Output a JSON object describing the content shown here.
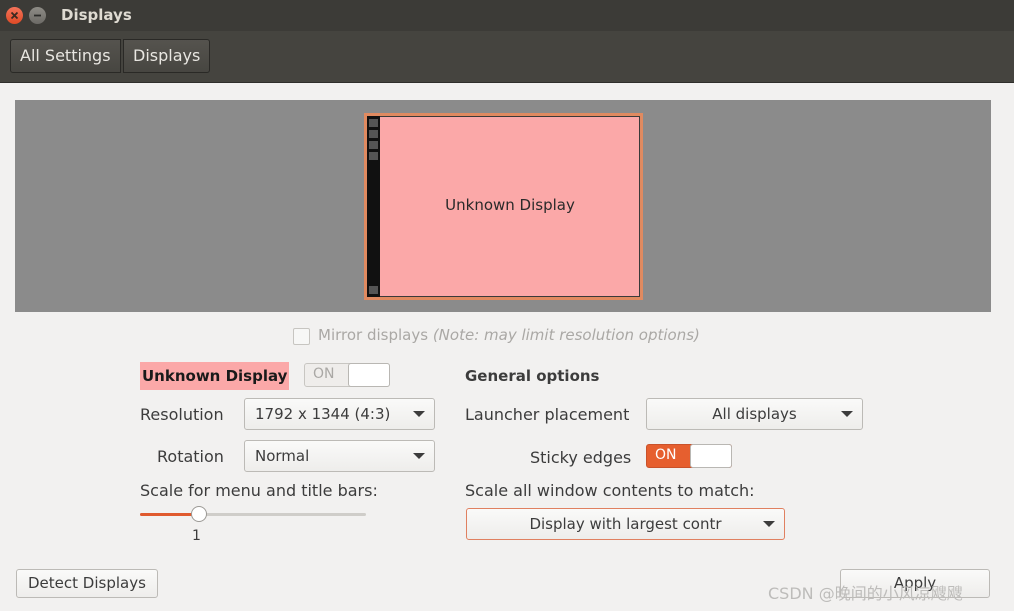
{
  "window": {
    "title": "Displays"
  },
  "toolbar": {
    "all_settings_label": "All Settings",
    "displays_label": "Displays"
  },
  "preview": {
    "monitor_label": "Unknown Display"
  },
  "mirror": {
    "label": "Mirror displays",
    "note": "(Note: may limit resolution options)",
    "checked": false,
    "enabled": false
  },
  "display": {
    "name": "Unknown Display",
    "toggle_label": "ON",
    "resolution_label": "Resolution",
    "resolution_value": "1792 x 1344 (4:3)",
    "rotation_label": "Rotation",
    "rotation_value": "Normal",
    "scale_label": "Scale for menu and title bars:",
    "scale_value": "1",
    "scale_fraction": 0.26
  },
  "general": {
    "title": "General options",
    "launcher_label": "Launcher placement",
    "launcher_value": "All displays",
    "sticky_label": "Sticky edges",
    "sticky_toggle_label": "ON",
    "window_scale_label": "Scale all window contents to match:",
    "window_scale_value": "Display with largest contr"
  },
  "buttons": {
    "detect_label": "Detect Displays",
    "apply_label": "Apply"
  },
  "watermark": "CSDN @晚间的小风凉飕飕",
  "colors": {
    "accent": "#e65f2f",
    "monitor_fill": "#fba8a8",
    "titlebar": "#3c3b37"
  }
}
